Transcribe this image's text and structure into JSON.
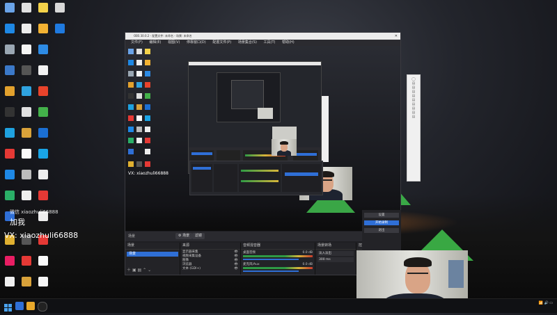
{
  "overlay": {
    "handle_line1": "加我",
    "handle_line2": "微信 xiaozhuli66888",
    "wx_label": "VX: ",
    "wx_id": "xiaozhuli66888"
  },
  "obs": {
    "title": "OBS 30.0.2 - 配置文件: 未命名 - 场景: 未命名",
    "menu": [
      "文件(F)",
      "编辑(E)",
      "视图(V)",
      "停靠窗口(D)",
      "配置文件(P)",
      "场景集合(S)",
      "工具(T)",
      "帮助(H)"
    ],
    "scene_tab_label": "场景",
    "filter_label": "滤镜",
    "docks": {
      "scenes": {
        "title": "场景",
        "items": [
          "场景"
        ]
      },
      "sources": {
        "title": "来源",
        "items": [
          "显示器采集",
          "视频采集设备",
          "图像",
          "浏览器",
          "文本 (GDI+)"
        ]
      },
      "mixer": {
        "title": "音频混音器",
        "channels": [
          {
            "name": "桌面音频",
            "db": "0.0 dB"
          },
          {
            "name": "麦克风/Aux",
            "db": "0.0 dB"
          }
        ]
      },
      "transitions": {
        "title": "场景转场",
        "type": "淡入淡出",
        "duration": "300 ms"
      },
      "controls": {
        "title": "控件",
        "buttons": [
          "开始直播",
          "开始录制",
          "启动虚拟摄像机",
          "工作室模式",
          "设置",
          "退出"
        ]
      }
    }
  },
  "colors": {
    "accent": "#2f6fd6",
    "tent": "#3db84a"
  }
}
